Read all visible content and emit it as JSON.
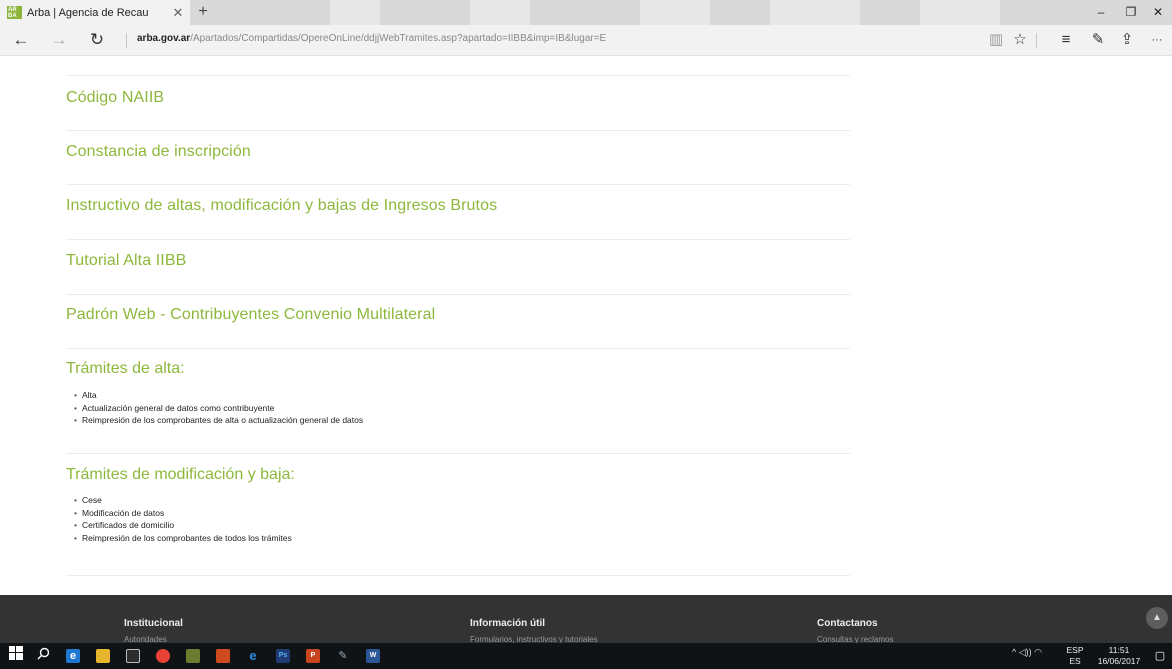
{
  "browser": {
    "tab_title": "Arba | Agencia de Recau",
    "favicon_text": "AR BA",
    "tab_close": "✕",
    "new_tab": "+",
    "url_domain": "arba.gov.ar",
    "url_path": "/Apartados/Compartidas/OpereOnLine/ddjjWebTramites.asp?apartado=IIBB&imp=IB&lugar=E",
    "back": "←",
    "forward": "→",
    "refresh": "↻",
    "minimize": "–",
    "restore": "❐",
    "close": "✕",
    "reading_view": "▥",
    "favorite": "☆",
    "hub": "≡",
    "notes": "✎",
    "share": "⇪",
    "more": "···"
  },
  "links": [
    "Código NAIIB",
    "Constancia de inscripción",
    "Instructivo de altas, modificación y bajas de Ingresos Brutos",
    "Tutorial Alta IIBB",
    "Padrón Web - Contribuyentes Convenio Multilateral"
  ],
  "tramites_alta": {
    "title": "Trámites de alta:",
    "items": [
      "Alta",
      "Actualización general de datos como contribuyente",
      "Reimpresión de los comprobantes de alta o actualización general de datos"
    ]
  },
  "tramites_mod": {
    "title": "Trámites de modificación y baja:",
    "items": [
      "Cese",
      "Modificación de datos",
      "Certificados de domicilio",
      "Reimpresión de los comprobantes de todos los trámites"
    ]
  },
  "footer": {
    "col1_title": "Institucional",
    "col1_sub": "Autoridades",
    "col2_title": "Información útil",
    "col2_sub": "Formularios, instructivos y tutoriales",
    "col3_title": "Contactanos",
    "col3_sub": "Consultas y reclamos",
    "scroll_top": "▲"
  },
  "taskbar": {
    "lang": "ESP",
    "lang_sub": "ES",
    "time": "11:51",
    "date": "16/06/2017",
    "tray_icons": "^ ◁)) ◠"
  },
  "colors": {
    "accent_green": "#8db83c",
    "footer_bg": "#333333",
    "taskbar_bg": "#101316"
  }
}
